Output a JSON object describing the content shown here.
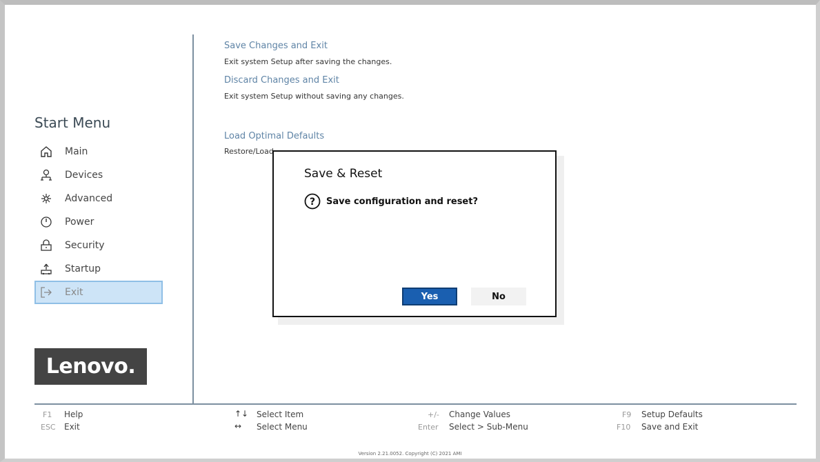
{
  "sidebar": {
    "title": "Start Menu",
    "items": [
      {
        "label": "Main",
        "icon": "home-icon"
      },
      {
        "label": "Devices",
        "icon": "devices-icon"
      },
      {
        "label": "Advanced",
        "icon": "advanced-icon"
      },
      {
        "label": "Power",
        "icon": "power-icon"
      },
      {
        "label": "Security",
        "icon": "lock-icon"
      },
      {
        "label": "Startup",
        "icon": "startup-icon"
      },
      {
        "label": "Exit",
        "icon": "exit-icon",
        "active": true
      }
    ],
    "logo": "Lenovo."
  },
  "main": {
    "options": [
      {
        "title": "Save Changes and Exit",
        "desc": "Exit system Setup after saving the changes."
      },
      {
        "title": "Discard Changes and Exit",
        "desc": "Exit system Setup without saving any changes."
      },
      {
        "title": "Load Optimal Defaults",
        "desc": "Restore/Load"
      }
    ]
  },
  "dialog": {
    "title": "Save & Reset",
    "message": "Save configuration and reset?",
    "yes_label": "Yes",
    "no_label": "No"
  },
  "footer": {
    "hints": [
      {
        "key": "F1",
        "label": "Help"
      },
      {
        "key": "ESC",
        "label": "Exit"
      },
      {
        "key": "↑↓",
        "label": "Select Item"
      },
      {
        "key": "↔",
        "label": "Select Menu"
      },
      {
        "key": "+/-",
        "label": "Change Values"
      },
      {
        "key": "Enter",
        "label": "Select > Sub-Menu"
      },
      {
        "key": "F9",
        "label": "Setup Defaults"
      },
      {
        "key": "F10",
        "label": "Save and Exit"
      }
    ],
    "version": "Version 2.21.0052. Copyright (C) 2021 AMI"
  },
  "colors": {
    "accent": "#1a5fb0",
    "option_title": "#5f84a6",
    "active_item_bg": "#cde4f7",
    "divider": "#7c8fa0"
  }
}
